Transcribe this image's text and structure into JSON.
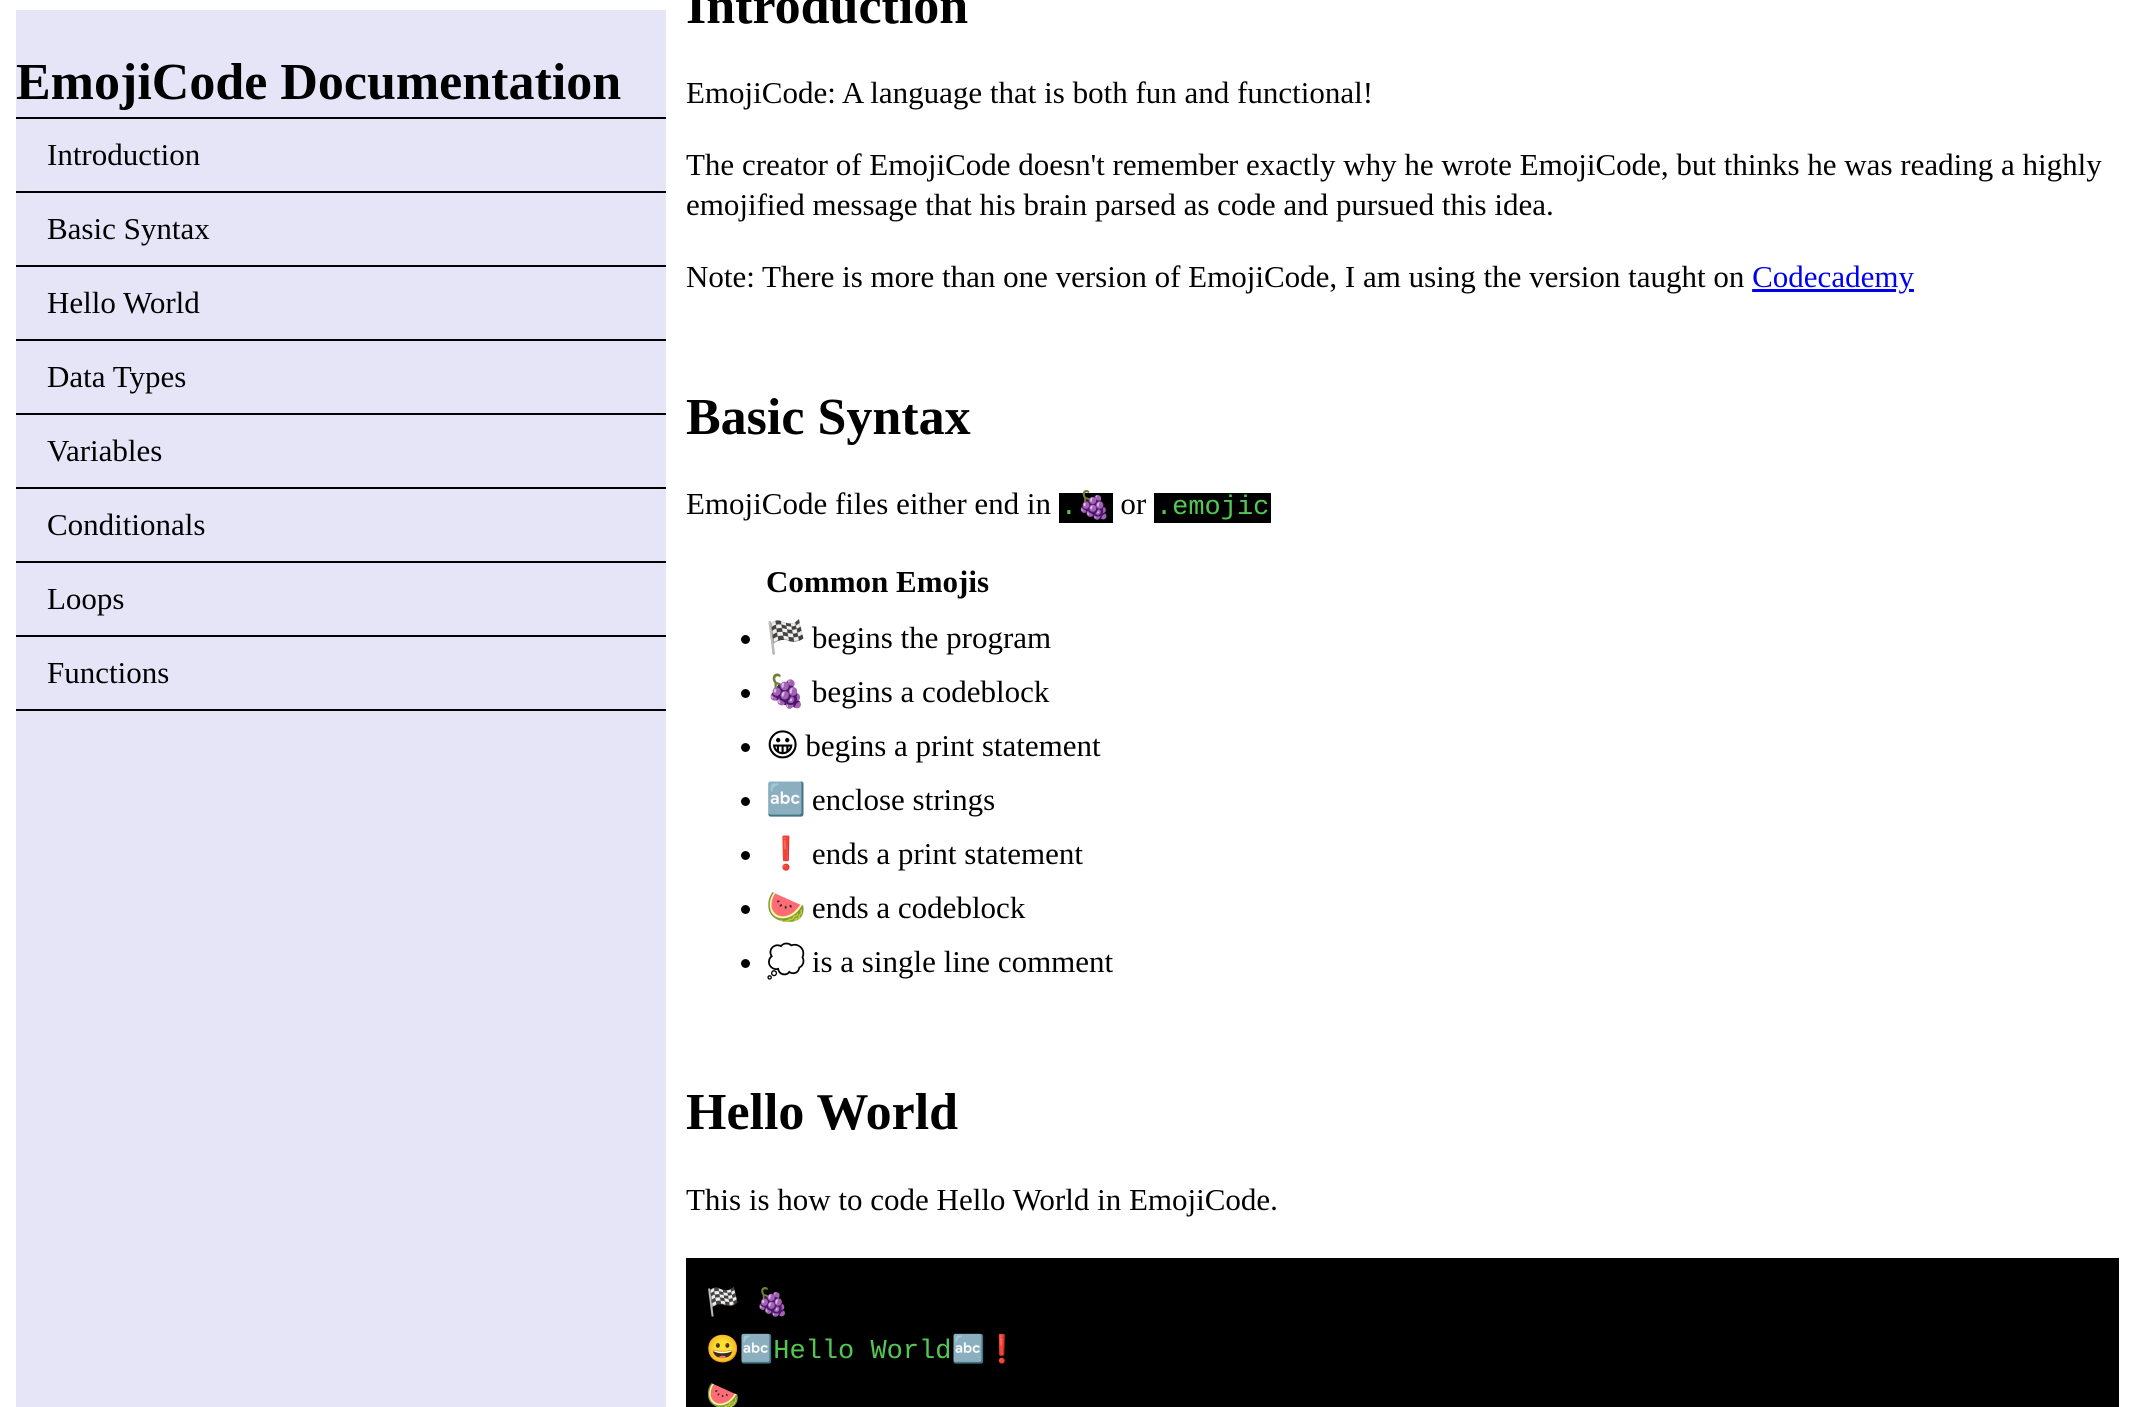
{
  "sidebar": {
    "title": "EmojiCode Documentation",
    "items": [
      {
        "label": "Introduction"
      },
      {
        "label": "Basic Syntax"
      },
      {
        "label": "Hello World"
      },
      {
        "label": "Data Types"
      },
      {
        "label": "Variables"
      },
      {
        "label": "Conditionals"
      },
      {
        "label": "Loops"
      },
      {
        "label": "Functions"
      }
    ]
  },
  "intro": {
    "heading": "Introduction",
    "p1": "EmojiCode: A language that is both fun and functional!",
    "p2": "The creator of EmojiCode doesn't remember exactly why he wrote EmojiCode, but thinks he was reading a highly emojified message that his brain parsed as code and pursued this idea.",
    "p3_text": "Note: There is more than one version of EmojiCode, I am using the version taught on ",
    "p3_link": "Codecademy"
  },
  "basic": {
    "heading": "Basic Syntax",
    "p_text": "EmojiCode files either end in ",
    "ext1": ".🍇",
    "or_text": " or ",
    "ext2": ".emojic",
    "list_heading": "Common Emojis",
    "items": [
      {
        "emoji": "🏁",
        "text": "begins the program"
      },
      {
        "emoji": "🍇",
        "text": "begins a codeblock"
      },
      {
        "emoji": "😀",
        "text": "begins a print statement"
      },
      {
        "emoji": "🔤",
        "text": "enclose strings"
      },
      {
        "emoji": "❗",
        "text": "ends a print statement"
      },
      {
        "emoji": "🍉",
        "text": "ends a codeblock"
      },
      {
        "emoji": "💭",
        "text": "is a single line comment"
      }
    ]
  },
  "hello": {
    "heading": "Hello World",
    "p": "This is how to code Hello World in EmojiCode.",
    "code": {
      "line1": "🏁 🍇",
      "line2": "😀🔤Hello World🔤❗",
      "line3": "🍉"
    }
  },
  "colors": {
    "sidebar_bg": "#e6e5f8",
    "code_bg": "#000000",
    "code_fg": "#54c654",
    "link": "#0000ee"
  }
}
